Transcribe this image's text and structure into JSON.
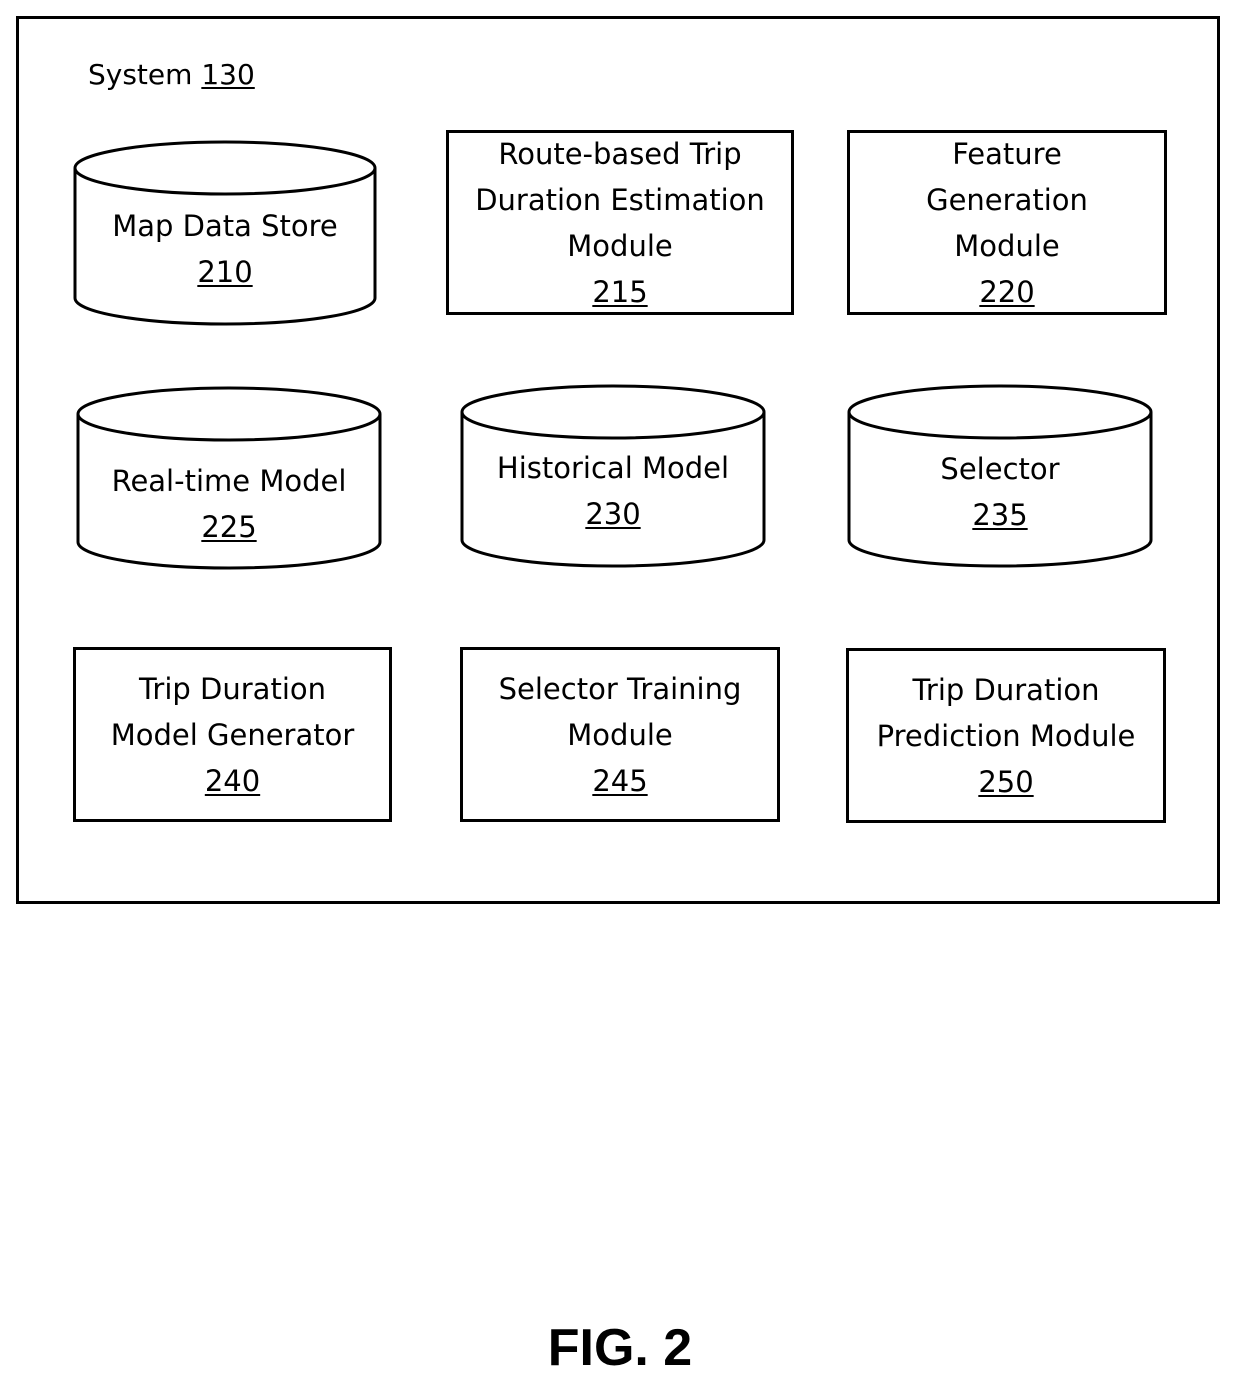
{
  "system": {
    "label": "System",
    "ref": "130"
  },
  "components": [
    {
      "id": "map-data-store",
      "shape": "cylinder",
      "lines": [
        "Map Data Store"
      ],
      "ref": "210"
    },
    {
      "id": "route-based-trip-duration-estimation-module",
      "shape": "box",
      "lines": [
        "Route-based Trip",
        "Duration Estimation",
        "Module"
      ],
      "ref": "215"
    },
    {
      "id": "feature-generation-module",
      "shape": "box",
      "lines": [
        "Feature",
        "Generation",
        "Module"
      ],
      "ref": "220"
    },
    {
      "id": "real-time-model",
      "shape": "cylinder",
      "lines": [
        "Real-time Model"
      ],
      "ref": "225"
    },
    {
      "id": "historical-model",
      "shape": "cylinder",
      "lines": [
        "Historical Model"
      ],
      "ref": "230"
    },
    {
      "id": "selector",
      "shape": "cylinder",
      "lines": [
        "Selector"
      ],
      "ref": "235"
    },
    {
      "id": "trip-duration-model-generator",
      "shape": "box",
      "lines": [
        "Trip Duration",
        "Model Generator"
      ],
      "ref": "240"
    },
    {
      "id": "selector-training-module",
      "shape": "box",
      "lines": [
        "Selector Training",
        "Module"
      ],
      "ref": "245"
    },
    {
      "id": "trip-duration-prediction-module",
      "shape": "box",
      "lines": [
        "Trip Duration",
        "Prediction Module"
      ],
      "ref": "250"
    }
  ],
  "figure_caption": "FIG. 2"
}
